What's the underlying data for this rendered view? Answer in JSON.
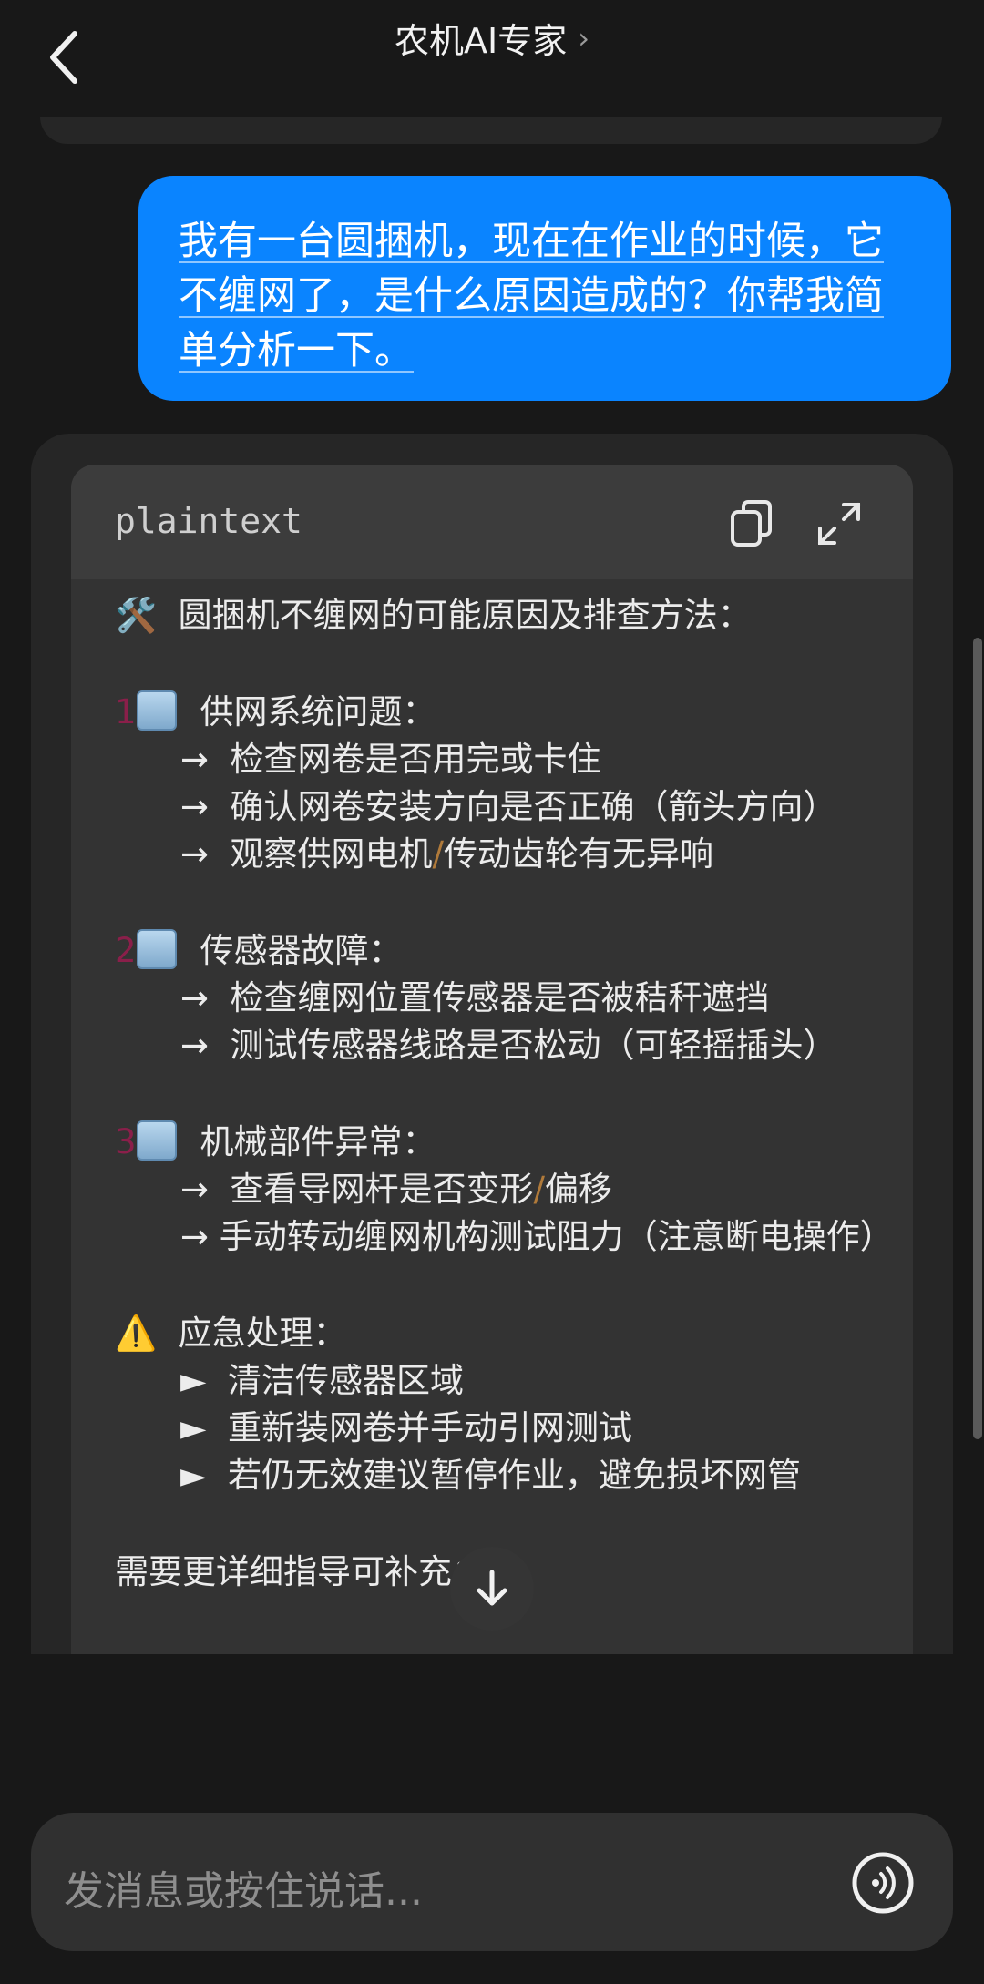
{
  "header": {
    "title": "农机AI专家",
    "title_chevron": "›",
    "back_icon": "chevron-left-icon"
  },
  "user_message": {
    "text": "我有一台圆捆机，现在在作业的时候，它不缠网了，是什么原因造成的？你帮我简单分析一下。",
    "bubble_color": "#0a84ff"
  },
  "code_block": {
    "language": "plaintext",
    "copy_icon": "copy-icon",
    "expand_icon": "expand-icon",
    "title_line": {
      "emoji": "🛠️",
      "text": "圆捆机不缠网的可能原因及排查方法："
    },
    "section1": {
      "num": "1",
      "title": "供网系统问题：",
      "items": [
        {
          "arrow": "→",
          "text": "检查网卷是否用完或卡住"
        },
        {
          "arrow": "→",
          "text": "确认网卷安装方向是否正确（箭头方向）"
        },
        {
          "arrow": "→",
          "pre": "观察供网电机",
          "slash": "/",
          "post": "传动齿轮有无异响"
        }
      ]
    },
    "section2": {
      "num": "2",
      "title": "传感器故障：",
      "items": [
        {
          "arrow": "→",
          "text": "检查缠网位置传感器是否被秸秆遮挡"
        },
        {
          "arrow": "→",
          "text": "测试传感器线路是否松动（可轻摇插头）"
        }
      ]
    },
    "section3": {
      "num": "3",
      "title": "机械部件异常：",
      "items": [
        {
          "arrow": "→",
          "pre": "查看导网杆是否变形",
          "slash": "/",
          "post": "偏移"
        },
        {
          "arrow": "→",
          "text": "手动转动缠网机构测试阻力（注意断电操作）"
        }
      ]
    },
    "emergency": {
      "emoji": "⚠️",
      "title": "应急处理：",
      "items": [
        {
          "bullet": "►",
          "text": "清洁传感器区域"
        },
        {
          "bullet": "►",
          "text": "重新装网卷并手动引网测试"
        },
        {
          "bullet": "►",
          "text": "若仍无效建议暂停作业，避免损坏网管"
        }
      ]
    },
    "footer_line": "需要更详细指导可补充："
  },
  "scroll_down_icon": "arrow-down-icon",
  "input": {
    "placeholder": "发消息或按住说话...",
    "voice_icon": "voice-icon"
  }
}
